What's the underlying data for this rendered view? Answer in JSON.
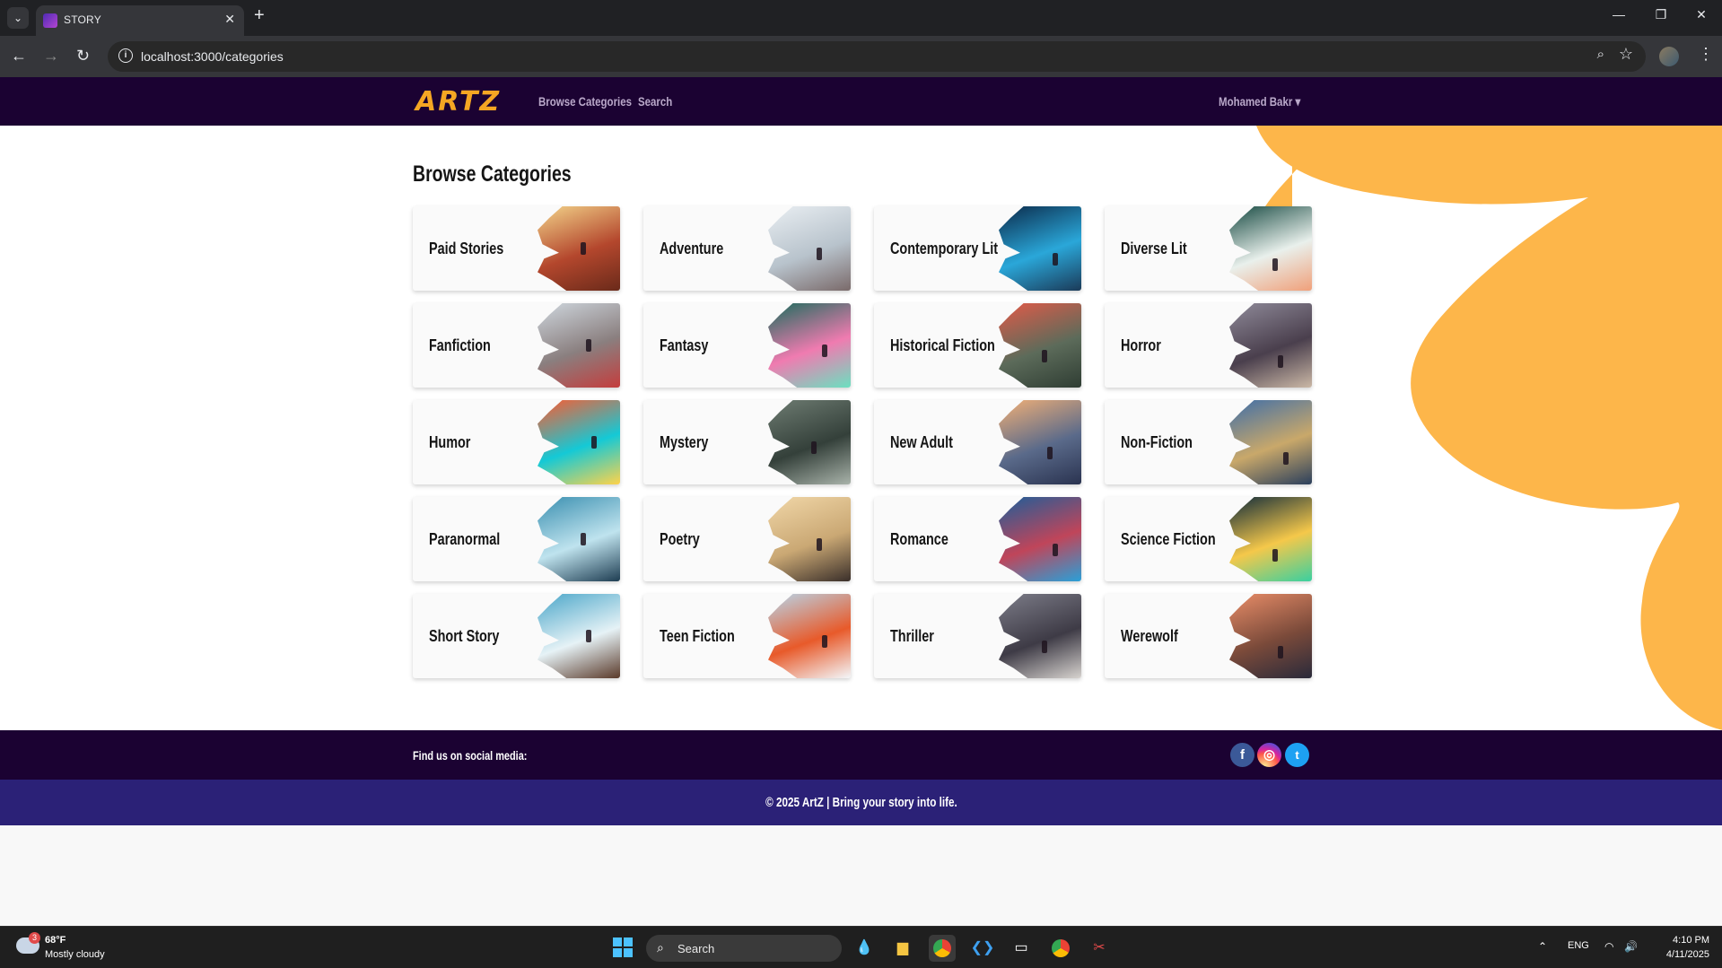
{
  "browser": {
    "tab_title": "STORY",
    "url": "localhost:3000/categories"
  },
  "site": {
    "logo": "ARTZ",
    "nav": [
      "Browse Categories",
      "Search"
    ],
    "user_name": "Mohamed Bakr",
    "accent_color": "#f5a623",
    "nav_bg": "#1b0232"
  },
  "page": {
    "heading": "Browse Categories",
    "categories": [
      "Paid Stories",
      "Adventure",
      "Contemporary Lit",
      "Diverse Lit",
      "Fanfiction",
      "Fantasy",
      "Historical Fiction",
      "Horror",
      "Humor",
      "Mystery",
      "New Adult",
      "Non-Fiction",
      "Paranormal",
      "Poetry",
      "Romance",
      "Science Fiction",
      "Short Story",
      "Teen Fiction",
      "Thriller",
      "Werewolf"
    ]
  },
  "footer": {
    "social_label": "Find us on social media:",
    "social_icons": [
      "facebook-icon",
      "instagram-icon",
      "twitter-icon"
    ],
    "copyright": "© 2025 ArtZ | Bring your story into life."
  },
  "taskbar": {
    "weather_badge": "3",
    "temperature": "68°F",
    "weather": "Mostly cloudy",
    "search_placeholder": "Search",
    "language": "ENG",
    "time": "4:10 PM",
    "date": "4/11/2025"
  }
}
